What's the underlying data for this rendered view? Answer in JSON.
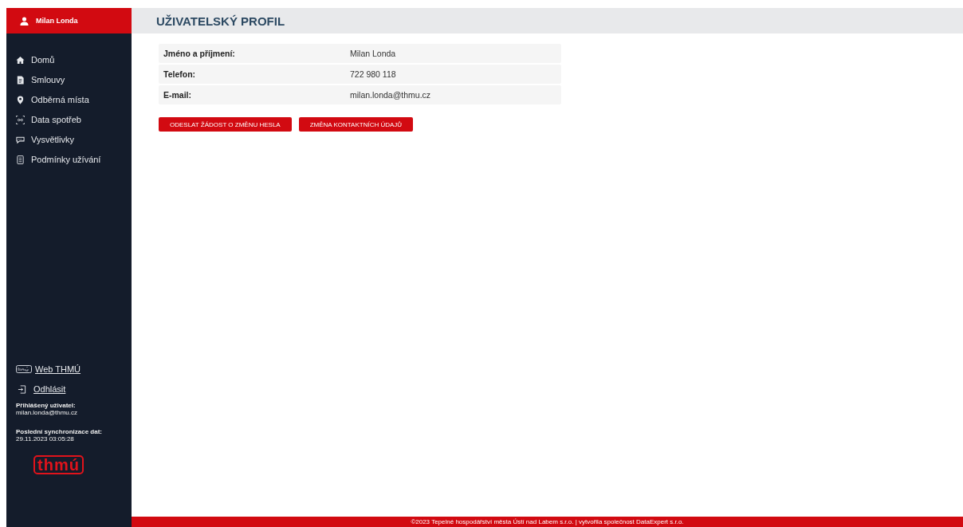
{
  "user": {
    "name": "Milan Londa"
  },
  "nav": [
    {
      "label": "Domů",
      "kind": "home"
    },
    {
      "label": "Smlouvy",
      "kind": "document"
    },
    {
      "label": "Odběrná místa",
      "kind": "pin"
    },
    {
      "label": "Data spotřeb",
      "kind": "nodes"
    },
    {
      "label": "Vysvětlivky",
      "kind": "speech"
    },
    {
      "label": "Podmínky užívání",
      "kind": "list"
    }
  ],
  "bottom_links": [
    {
      "label": "Web THMÚ",
      "kind": "badge"
    },
    {
      "label": "Odhlásit",
      "kind": "logout"
    }
  ],
  "info": [
    {
      "label": "Přihlášený uživatel:",
      "value": "milan.londa@thmu.cz"
    },
    {
      "label": "Poslední synchronizace dat:",
      "value": "29.11.2023 03:05:28"
    }
  ],
  "logo": "thmú",
  "page_title": "UŽIVATELSKÝ PROFIL",
  "profile": [
    {
      "label": "Jméno a příjmení:",
      "value": "Milan Londa"
    },
    {
      "label": "Telefon:",
      "value": "722 980 118"
    },
    {
      "label": "E-mail:",
      "value": "milan.londa@thmu.cz"
    }
  ],
  "buttons": [
    "ODESLAT ŽÁDOST O ZMĚNU HESLA",
    "ZMĚNA KONTAKTNÍCH ÚDAJŮ"
  ],
  "footer": "©2023 Tepelné hospodářství města Ústí nad Labem s.r.o. | vytvořila společnost DataExpert s.r.o."
}
